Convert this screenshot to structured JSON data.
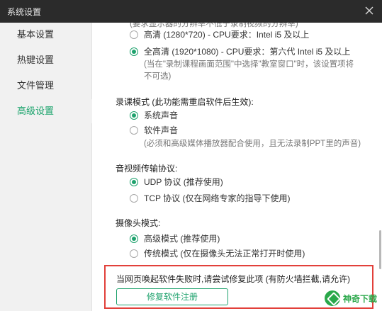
{
  "window": {
    "title": "系统设置"
  },
  "sidebar": {
    "items": [
      {
        "label": "基本设置"
      },
      {
        "label": "热键设置"
      },
      {
        "label": "文件管理"
      },
      {
        "label": "高级设置"
      }
    ],
    "active_index": 3
  },
  "content": {
    "resolution": {
      "cut_top_note": "(要求显示器的分辨率不低于录制视频的分辨率)",
      "options": [
        {
          "label": "高清 (1280*720) - CPU要求：Intel i5 及以上",
          "checked": false
        },
        {
          "label": "全高清 (1920*1080) - CPU要求：第六代 Intel i5 及以上",
          "checked": true
        }
      ],
      "note_line1": "(当在\"录制课程画面范围\"中选择\"教室窗口\"时，该设置项将",
      "note_line2": "不可选)"
    },
    "record_mode": {
      "title": "录课模式 (此功能需重启软件后生效):",
      "options": [
        {
          "label": "系统声音",
          "checked": true
        },
        {
          "label": "软件声音",
          "checked": false
        }
      ],
      "note": "(必须和高级媒体播放器配合使用，且无法录制PPT里的声音)"
    },
    "av_protocol": {
      "title": "音视频传输协议:",
      "options": [
        {
          "label": "UDP 协议 (推荐使用)",
          "checked": true
        },
        {
          "label": "TCP 协议 (仅在网络专家的指导下使用)",
          "checked": false
        }
      ]
    },
    "camera_mode": {
      "title": "摄像头模式:",
      "options": [
        {
          "label": "高级模式 (推荐使用)",
          "checked": true
        },
        {
          "label": "传统模式 (仅在摄像头无法正常打开时使用)",
          "checked": false
        }
      ]
    },
    "repair": {
      "text": "当网页唤起软件失败时,请尝试修复此项 (有防火墙拦截,请允许)",
      "button": "修复软件注册"
    }
  },
  "watermark": {
    "text": "神奇下载"
  },
  "colors": {
    "accent": "#1ea26d",
    "titlebar": "#2b2b2b",
    "sidebar": "#f1f1f1",
    "highlight_border": "#e2403a"
  }
}
